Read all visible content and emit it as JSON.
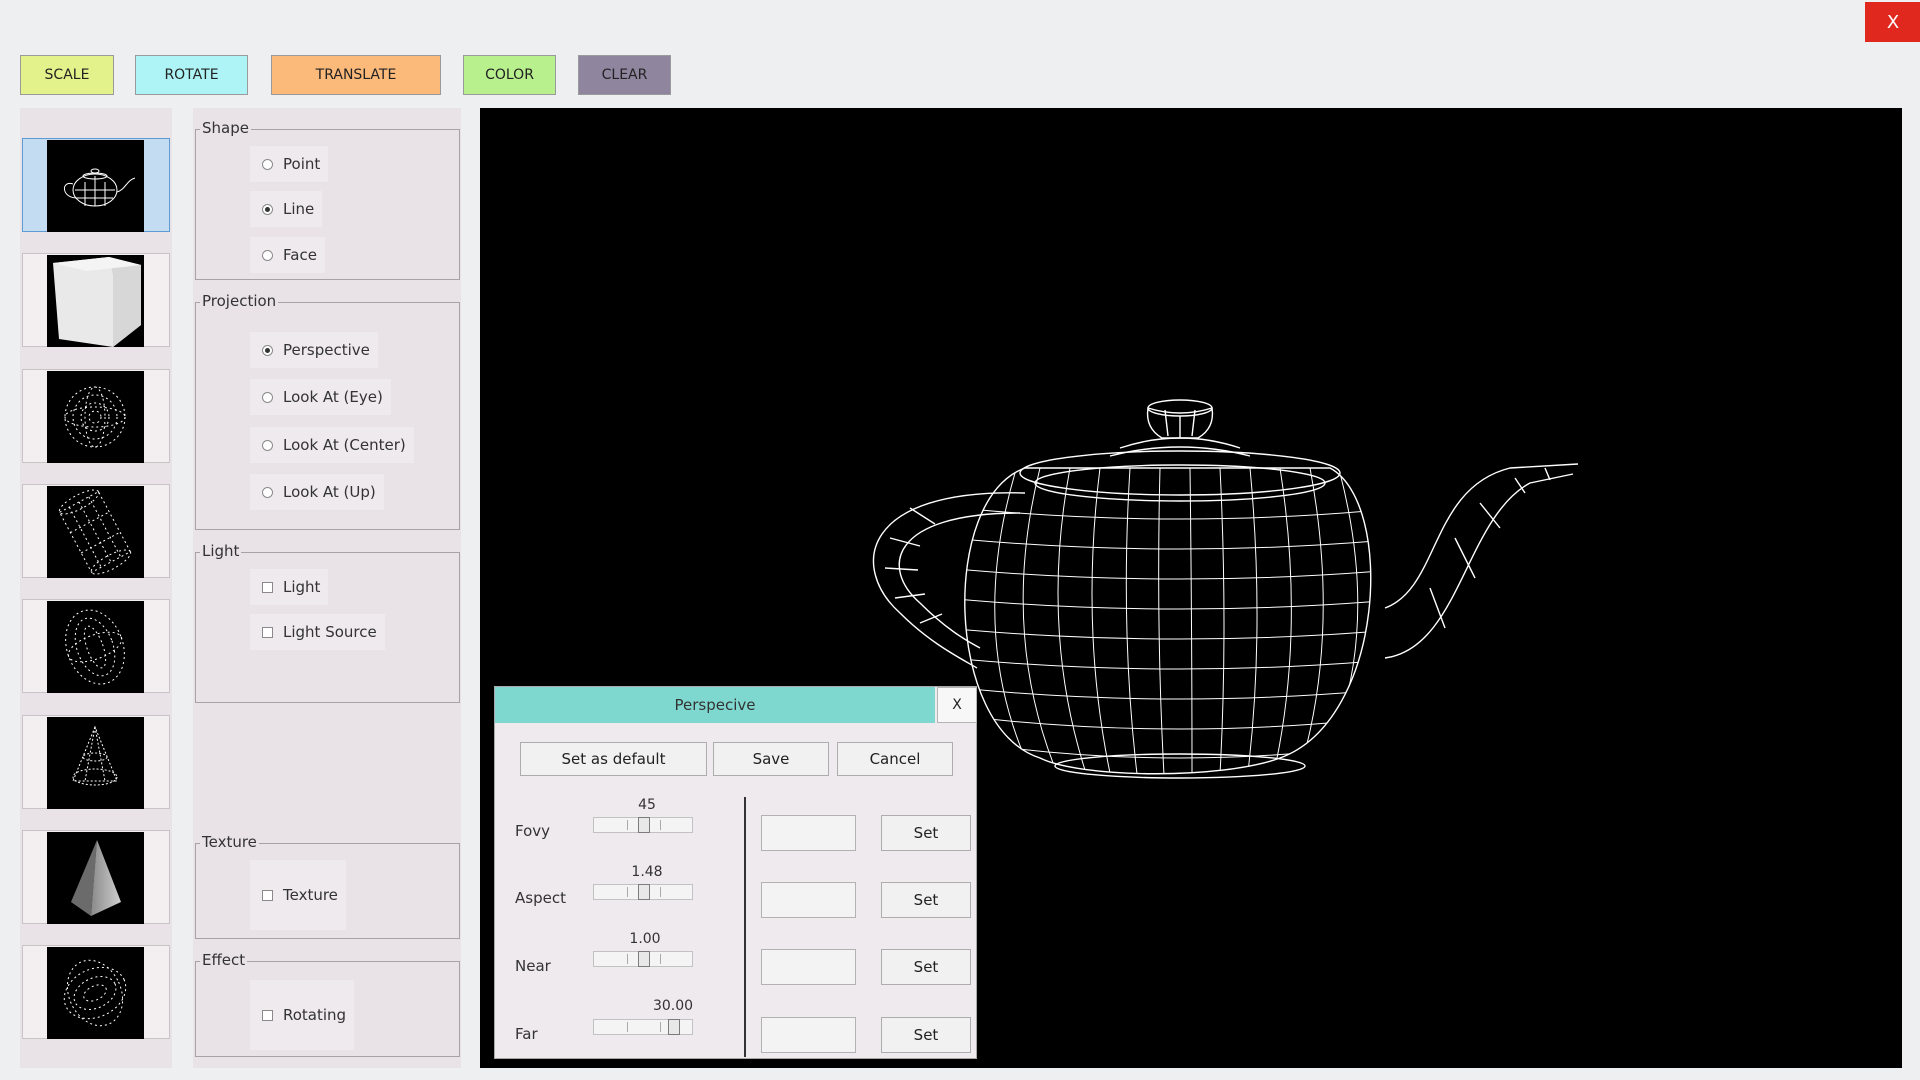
{
  "toolbar": {
    "buttons": [
      {
        "label": "SCALE",
        "color": "#e4f28b"
      },
      {
        "label": "ROTATE",
        "color": "#aef4f6"
      },
      {
        "label": "TRANSLATE",
        "color": "#fbb97a"
      },
      {
        "label": "COLOR",
        "color": "#b8f08d"
      },
      {
        "label": "CLEAR",
        "color": "#8f859f"
      }
    ],
    "close_label": "X",
    "close_color": "#e0281f"
  },
  "models": {
    "items": [
      {
        "icon": "teapot-icon",
        "selected": true
      },
      {
        "icon": "cube-icon",
        "selected": false
      },
      {
        "icon": "sphere-icon",
        "selected": false
      },
      {
        "icon": "cylinder-icon",
        "selected": false
      },
      {
        "icon": "ellipsoid-icon",
        "selected": false
      },
      {
        "icon": "cone-icon",
        "selected": false
      },
      {
        "icon": "pyramid-icon",
        "selected": false
      },
      {
        "icon": "torus-icon",
        "selected": false
      }
    ]
  },
  "shape": {
    "legend": "Shape",
    "options": [
      {
        "label": "Point",
        "checked": false
      },
      {
        "label": "Line",
        "checked": true
      },
      {
        "label": "Face",
        "checked": false
      }
    ]
  },
  "projection": {
    "legend": "Projection",
    "options": [
      {
        "label": "Perspective",
        "checked": true
      },
      {
        "label": "Look At (Eye)",
        "checked": false
      },
      {
        "label": "Look At (Center)",
        "checked": false
      },
      {
        "label": "Look At (Up)",
        "checked": false
      }
    ]
  },
  "light": {
    "legend": "Light",
    "options": [
      {
        "label": "Light",
        "checked": false
      },
      {
        "label": "Light Source",
        "checked": false
      }
    ]
  },
  "texture": {
    "legend": "Texture",
    "option": {
      "label": "Texture",
      "checked": false
    }
  },
  "effect": {
    "legend": "Effect",
    "option": {
      "label": "Rotating",
      "checked": false
    }
  },
  "viewport": {
    "background": "#000000",
    "render_mode": "wireframe",
    "model": "teapot"
  },
  "dialog": {
    "title": "Perspecive",
    "close_label": "X",
    "buttons": {
      "default": "Set as default",
      "save": "Save",
      "cancel": "Cancel"
    },
    "params": [
      {
        "label": "Fovy",
        "value": "45",
        "set": "Set",
        "slider_level": 0.5
      },
      {
        "label": "Aspect",
        "value": "1.48",
        "set": "Set",
        "slider_level": 0.5
      },
      {
        "label": "Near",
        "value": "1.00",
        "set": "Set",
        "slider_level": 0.5
      },
      {
        "label": "Far",
        "value": "30.00",
        "set": "Set",
        "slider_level": 0.8
      }
    ]
  }
}
